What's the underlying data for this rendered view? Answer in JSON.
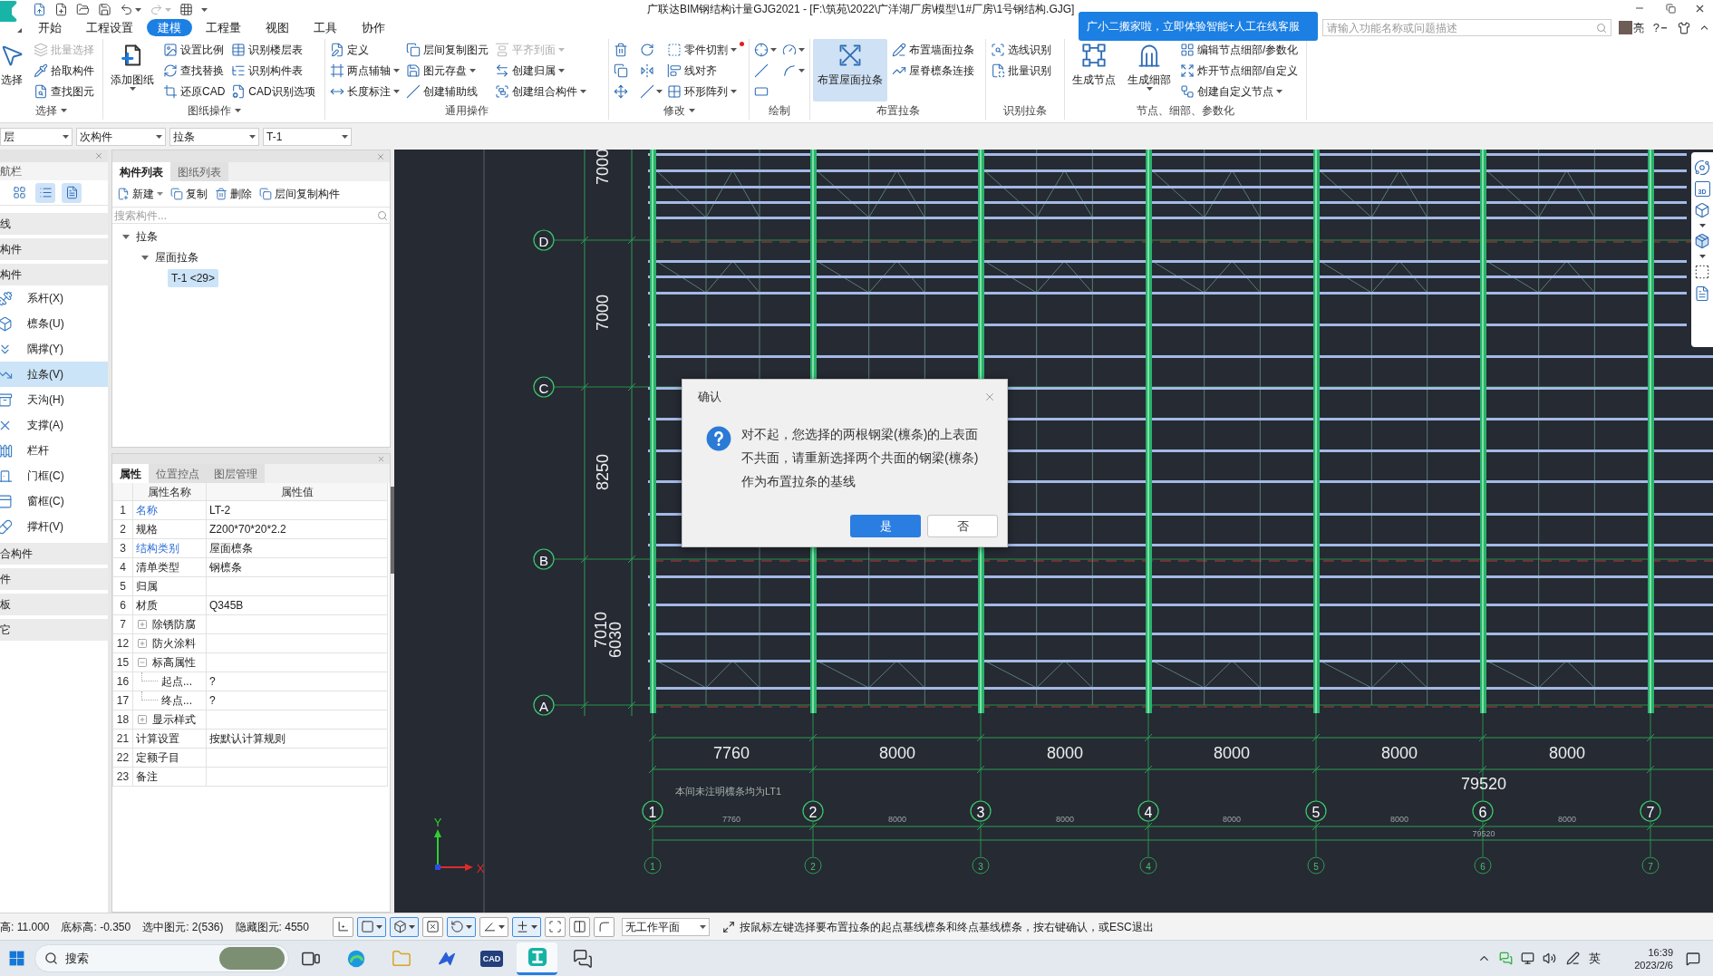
{
  "title_bar": {
    "title": "广联达BIM钢结构计量GJG2021 - [F:\\筑苑\\2022\\广洋湖厂房\\模型\\1#厂房\\1号钢结构.GJG]",
    "notice": "广小二搬家啦，立即体验智能+人工在线客服",
    "search": {
      "placeholder": "请输入功能名称或问题描述"
    },
    "user": "亮",
    "help": "?"
  },
  "tabs": [
    {
      "label": "开始",
      "selected": false
    },
    {
      "label": "工程设置",
      "selected": false
    },
    {
      "label": "建模",
      "selected": true
    },
    {
      "label": "工程量",
      "selected": false
    },
    {
      "label": "视图",
      "selected": false
    },
    {
      "label": "工具",
      "selected": false
    },
    {
      "label": "协作",
      "selected": false
    }
  ],
  "ribbon": [
    {
      "label": "选择",
      "menu": true,
      "columns": [
        {
          "kind": "large",
          "items": [
            {
              "label": "选择",
              "menu": false,
              "disabled": false,
              "active": false
            }
          ]
        },
        {
          "kind": "stack",
          "items": [
            {
              "label": "批量选择",
              "menu": false,
              "disabled": true,
              "active": false
            },
            {
              "label": "拾取构件",
              "menu": false,
              "disabled": false,
              "active": false
            },
            {
              "label": "查找图元",
              "menu": false,
              "disabled": false,
              "active": false
            }
          ]
        }
      ]
    },
    {
      "label": "图纸操作",
      "menu": true,
      "columns": [
        {
          "kind": "large",
          "items": [
            {
              "label": "添加图纸",
              "menu": true,
              "disabled": false,
              "active": false
            }
          ]
        },
        {
          "kind": "stack",
          "items": [
            {
              "label": "设置比例",
              "menu": false,
              "disabled": false,
              "active": false
            },
            {
              "label": "查找替换",
              "menu": false,
              "disabled": false,
              "active": false
            },
            {
              "label": "还原CAD",
              "menu": false,
              "disabled": false,
              "active": false
            }
          ]
        },
        {
          "kind": "stack",
          "items": [
            {
              "label": "识别楼层表",
              "menu": false,
              "disabled": false,
              "active": false
            },
            {
              "label": "识别构件表",
              "menu": false,
              "disabled": false,
              "active": false
            },
            {
              "label": "CAD识别选项",
              "menu": false,
              "disabled": false,
              "active": false
            }
          ]
        }
      ]
    },
    {
      "label": "通用操作",
      "menu": false,
      "columns": [
        {
          "kind": "stack",
          "items": [
            {
              "label": "定义",
              "menu": false,
              "disabled": false,
              "active": false
            },
            {
              "label": "两点辅轴",
              "menu": true,
              "disabled": false,
              "active": false
            },
            {
              "label": "长度标注",
              "menu": true,
              "disabled": false,
              "active": false
            }
          ]
        },
        {
          "kind": "stack",
          "items": [
            {
              "label": "层间复制图元",
              "menu": false,
              "disabled": false,
              "active": false
            },
            {
              "label": "图元存盘",
              "menu": true,
              "disabled": false,
              "active": false
            },
            {
              "label": "创建辅助线",
              "menu": false,
              "disabled": false,
              "active": false
            }
          ]
        },
        {
          "kind": "stack",
          "items": [
            {
              "label": "平齐到面",
              "menu": true,
              "disabled": true,
              "active": false
            },
            {
              "label": "创建归属",
              "menu": true,
              "disabled": false,
              "active": false
            },
            {
              "label": "创建组合构件",
              "menu": true,
              "disabled": false,
              "active": false
            }
          ]
        }
      ]
    },
    {
      "label": "修改",
      "menu": true,
      "columns": [
        {
          "kind": "grid",
          "items": [
            {
              "menu": false
            },
            {
              "menu": false
            },
            {
              "menu": false
            },
            {
              "menu": false
            },
            {
              "menu": false
            },
            {
              "menu": true
            }
          ]
        },
        {
          "kind": "stack",
          "items": [
            {
              "label": "零件切割",
              "menu": true,
              "disabled": false,
              "active": false,
              "dot": true
            },
            {
              "label": "线对齐",
              "menu": false,
              "disabled": false,
              "active": false,
              "dot": false
            },
            {
              "label": "环形阵列",
              "menu": true,
              "disabled": false,
              "active": false,
              "dot": false
            }
          ]
        }
      ]
    },
    {
      "label": "绘制",
      "menu": false,
      "columns": [
        {
          "kind": "grid",
          "items": [
            {
              "menu": true
            },
            {
              "menu": true
            },
            {
              "menu": false
            },
            {
              "menu": true
            },
            {
              "menu": false
            }
          ]
        }
      ]
    },
    {
      "label": "布置拉条",
      "menu": false,
      "columns": [
        {
          "kind": "large",
          "items": [
            {
              "label": "布置屋面拉条",
              "menu": false,
              "disabled": false,
              "active": true
            }
          ]
        },
        {
          "kind": "stack",
          "items": [
            {
              "label": "布置墙面拉条",
              "menu": false,
              "disabled": false,
              "active": false
            },
            {
              "label": "屋脊檩条连接",
              "menu": false,
              "disabled": false,
              "active": false
            }
          ]
        }
      ]
    },
    {
      "label": "识别拉条",
      "menu": false,
      "columns": [
        {
          "kind": "stack",
          "items": [
            {
              "label": "选线识别",
              "menu": false,
              "disabled": false,
              "active": false
            },
            {
              "label": "批量识别",
              "menu": false,
              "disabled": false,
              "active": false
            }
          ]
        }
      ]
    },
    {
      "label": "节点、细部、参数化",
      "menu": false,
      "columns": [
        {
          "kind": "large",
          "items": [
            {
              "label": "生成节点",
              "menu": false,
              "disabled": false,
              "active": false
            }
          ]
        },
        {
          "kind": "large",
          "items": [
            {
              "label": "生成细部",
              "menu": true,
              "disabled": false,
              "active": false
            }
          ]
        },
        {
          "kind": "stack",
          "items": [
            {
              "label": "编辑节点细部/参数化",
              "menu": false,
              "disabled": false,
              "active": false
            },
            {
              "label": "炸开节点细部/自定义",
              "menu": false,
              "disabled": false,
              "active": false
            },
            {
              "label": "创建自定义节点",
              "menu": true,
              "disabled": false,
              "active": false
            }
          ]
        }
      ]
    }
  ],
  "selectors": [
    "层",
    "次构件",
    "拉条",
    "T-1"
  ],
  "nav_panel": {
    "title": "航栏",
    "views": [
      {
        "selected": false
      },
      {
        "selected": true
      },
      {
        "selected": true
      }
    ],
    "categories": [
      {
        "label": "线"
      },
      {
        "label": "构件"
      },
      {
        "label": "构件",
        "children": [
          {
            "label": "系杆(X)",
            "selected": false
          },
          {
            "label": "檩条(U)",
            "selected": false
          },
          {
            "label": "隅撑(Y)",
            "selected": false
          },
          {
            "label": "拉条(V)",
            "selected": true
          },
          {
            "label": "天沟(H)",
            "selected": false
          },
          {
            "label": "支撑(A)",
            "selected": false
          },
          {
            "label": "栏杆",
            "selected": false
          },
          {
            "label": "门框(C)",
            "selected": false
          },
          {
            "label": "窗框(C)",
            "selected": false
          },
          {
            "label": "撑杆(V)",
            "selected": false
          }
        ]
      },
      {
        "label": "合构件"
      },
      {
        "label": "件"
      },
      {
        "label": "板"
      },
      {
        "label": "它"
      }
    ]
  },
  "component_panel": {
    "tabs": [
      {
        "label": "构件列表",
        "selected": true
      },
      {
        "label": "图纸列表",
        "selected": false
      }
    ],
    "toolbar": [
      {
        "label": "新建",
        "menu": true
      },
      {
        "label": "复制",
        "menu": false
      },
      {
        "label": "删除",
        "menu": false
      },
      {
        "label": "层间复制构件",
        "menu": false
      }
    ],
    "search": {
      "placeholder": "搜索构件..."
    },
    "tree": [
      {
        "label": "拉条",
        "expanded": true,
        "selected": false,
        "children": [
          {
            "label": "屋面拉条",
            "expanded": true,
            "selected": false,
            "children": [
              {
                "label": "T-1 <29>",
                "selected": true
              }
            ]
          }
        ]
      }
    ]
  },
  "properties_panel": {
    "tabs": [
      {
        "label": "属性",
        "selected": true
      },
      {
        "label": "位置控点",
        "selected": false
      },
      {
        "label": "图层管理",
        "selected": false
      }
    ],
    "columns": [
      "属性名称",
      "属性值"
    ],
    "rows": [
      {
        "num": "1",
        "kind": "field",
        "name": "名称",
        "value": "LT-2",
        "emphasized": true
      },
      {
        "num": "2",
        "kind": "field",
        "name": "规格",
        "value": "Z200*70*20*2.2",
        "emphasized": false
      },
      {
        "num": "3",
        "kind": "field",
        "name": "结构类别",
        "value": "屋面檩条",
        "emphasized": true
      },
      {
        "num": "4",
        "kind": "field",
        "name": "清单类型",
        "value": "钢檩条",
        "emphasized": false
      },
      {
        "num": "5",
        "kind": "field",
        "name": "归属",
        "emphasized": false
      },
      {
        "num": "6",
        "kind": "field",
        "name": "材质",
        "value": "Q345B",
        "emphasized": false
      },
      {
        "num": "7",
        "kind": "group",
        "name": "除锈防腐",
        "expanded": false,
        "emphasized": false
      },
      {
        "num": "12",
        "kind": "group",
        "name": "防火涂料",
        "expanded": false,
        "emphasized": false
      },
      {
        "num": "15",
        "kind": "group",
        "name": "标高属性",
        "expanded": true,
        "emphasized": false
      },
      {
        "num": "16",
        "kind": "child",
        "name": "起点...",
        "value": "?",
        "emphasized": false
      },
      {
        "num": "17",
        "kind": "child",
        "name": "终点...",
        "value": "?",
        "emphasized": false
      },
      {
        "num": "18",
        "kind": "group",
        "name": "显示样式",
        "expanded": false,
        "emphasized": false
      },
      {
        "num": "21",
        "kind": "field",
        "name": "计算设置",
        "value": "按默认计算规则",
        "emphasized": false
      },
      {
        "num": "22",
        "kind": "field",
        "name": "定额子目",
        "emphasized": false
      },
      {
        "num": "23",
        "kind": "field",
        "name": "备注",
        "emphasized": false
      }
    ]
  },
  "drawing": {
    "row_axes": [
      "D",
      "C",
      "B",
      "A"
    ],
    "row_dimensions": [
      "7000",
      "7000",
      "8250",
      "7010",
      "6030"
    ],
    "column_dimensions": [
      "7760",
      "8000",
      "8000",
      "8000",
      "8000",
      "8000"
    ],
    "total_dimension": "79520",
    "column_axes": [
      "1",
      "2",
      "3",
      "4",
      "5",
      "6",
      "7"
    ],
    "note": "本间未注明檩条均为LT1",
    "detail_dimensions": [
      "7760",
      "8000",
      "8000",
      "8000",
      "8000",
      "8000"
    ],
    "detail_total": "79520",
    "detail_axes": [
      "1",
      "2",
      "3",
      "4",
      "5",
      "6",
      "7"
    ],
    "ucs": {
      "x": "X",
      "y": "Y"
    },
    "view_toolbar": {
      "badge": "3D"
    }
  },
  "dialog": {
    "title": "确认",
    "message_lines": [
      "对不起，您选择的两根钢梁(檩条)的上表面",
      "不共面，请重新选择两个共面的钢梁(檩条)",
      "作为布置拉条的基线"
    ],
    "buttons": [
      {
        "label": "是",
        "primary": true
      },
      {
        "label": "否",
        "primary": false
      }
    ]
  },
  "status_bar": {
    "readouts": [
      "高: 11.000",
      "底标高: -0.350",
      "选中图元: 2(536)",
      "隐藏图元: 4550"
    ],
    "snap_tools": [
      {
        "selected": false,
        "menu": false
      },
      {
        "selected": true,
        "menu": true
      },
      {
        "selected": true,
        "menu": true
      },
      {
        "selected": false,
        "menu": false
      },
      {
        "selected": true,
        "menu": true
      },
      {
        "selected": false,
        "menu": true
      },
      {
        "selected": true,
        "menu": true
      },
      {
        "selected": false,
        "menu": false
      },
      {
        "selected": false,
        "menu": false
      },
      {
        "selected": false,
        "menu": false
      }
    ],
    "plane": "无工作平面",
    "hint": "按鼠标左键选择要布置拉条的起点基线檩条和终点基线檩条，按右键确认，或ESC退出"
  },
  "taskbar": {
    "search": "搜索",
    "apps": [
      {
        "selected": false
      },
      {
        "selected": false
      },
      {
        "selected": false
      },
      {
        "selected": false
      },
      {
        "selected": false,
        "label": "CAD"
      },
      {
        "selected": true
      },
      {
        "selected": false
      }
    ],
    "ime": "英",
    "time": "16:39",
    "date": "2023/2/6"
  }
}
